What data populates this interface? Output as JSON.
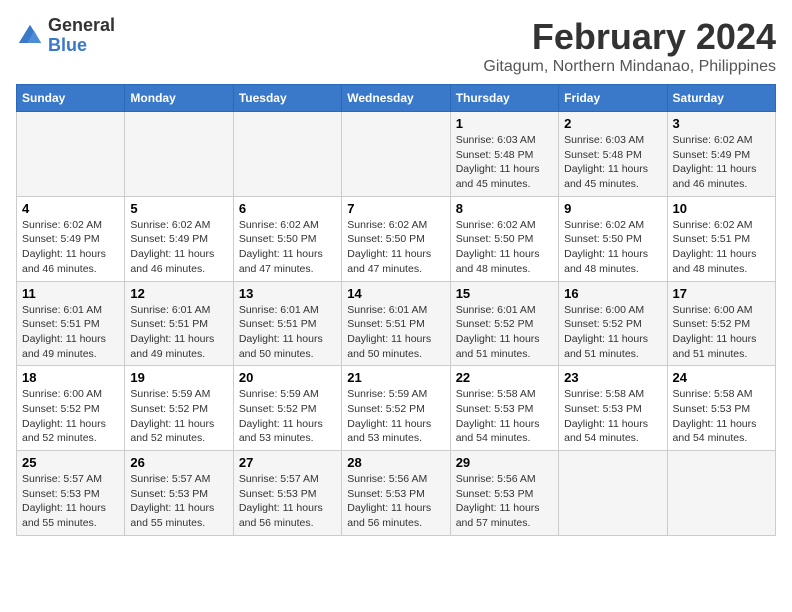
{
  "logo": {
    "line1": "General",
    "line2": "Blue"
  },
  "title": "February 2024",
  "subtitle": "Gitagum, Northern Mindanao, Philippines",
  "days_of_week": [
    "Sunday",
    "Monday",
    "Tuesday",
    "Wednesday",
    "Thursday",
    "Friday",
    "Saturday"
  ],
  "weeks": [
    [
      {
        "day": "",
        "info": ""
      },
      {
        "day": "",
        "info": ""
      },
      {
        "day": "",
        "info": ""
      },
      {
        "day": "",
        "info": ""
      },
      {
        "day": "1",
        "info": "Sunrise: 6:03 AM\nSunset: 5:48 PM\nDaylight: 11 hours and 45 minutes."
      },
      {
        "day": "2",
        "info": "Sunrise: 6:03 AM\nSunset: 5:48 PM\nDaylight: 11 hours and 45 minutes."
      },
      {
        "day": "3",
        "info": "Sunrise: 6:02 AM\nSunset: 5:49 PM\nDaylight: 11 hours and 46 minutes."
      }
    ],
    [
      {
        "day": "4",
        "info": "Sunrise: 6:02 AM\nSunset: 5:49 PM\nDaylight: 11 hours and 46 minutes."
      },
      {
        "day": "5",
        "info": "Sunrise: 6:02 AM\nSunset: 5:49 PM\nDaylight: 11 hours and 46 minutes."
      },
      {
        "day": "6",
        "info": "Sunrise: 6:02 AM\nSunset: 5:50 PM\nDaylight: 11 hours and 47 minutes."
      },
      {
        "day": "7",
        "info": "Sunrise: 6:02 AM\nSunset: 5:50 PM\nDaylight: 11 hours and 47 minutes."
      },
      {
        "day": "8",
        "info": "Sunrise: 6:02 AM\nSunset: 5:50 PM\nDaylight: 11 hours and 48 minutes."
      },
      {
        "day": "9",
        "info": "Sunrise: 6:02 AM\nSunset: 5:50 PM\nDaylight: 11 hours and 48 minutes."
      },
      {
        "day": "10",
        "info": "Sunrise: 6:02 AM\nSunset: 5:51 PM\nDaylight: 11 hours and 48 minutes."
      }
    ],
    [
      {
        "day": "11",
        "info": "Sunrise: 6:01 AM\nSunset: 5:51 PM\nDaylight: 11 hours and 49 minutes."
      },
      {
        "day": "12",
        "info": "Sunrise: 6:01 AM\nSunset: 5:51 PM\nDaylight: 11 hours and 49 minutes."
      },
      {
        "day": "13",
        "info": "Sunrise: 6:01 AM\nSunset: 5:51 PM\nDaylight: 11 hours and 50 minutes."
      },
      {
        "day": "14",
        "info": "Sunrise: 6:01 AM\nSunset: 5:51 PM\nDaylight: 11 hours and 50 minutes."
      },
      {
        "day": "15",
        "info": "Sunrise: 6:01 AM\nSunset: 5:52 PM\nDaylight: 11 hours and 51 minutes."
      },
      {
        "day": "16",
        "info": "Sunrise: 6:00 AM\nSunset: 5:52 PM\nDaylight: 11 hours and 51 minutes."
      },
      {
        "day": "17",
        "info": "Sunrise: 6:00 AM\nSunset: 5:52 PM\nDaylight: 11 hours and 51 minutes."
      }
    ],
    [
      {
        "day": "18",
        "info": "Sunrise: 6:00 AM\nSunset: 5:52 PM\nDaylight: 11 hours and 52 minutes."
      },
      {
        "day": "19",
        "info": "Sunrise: 5:59 AM\nSunset: 5:52 PM\nDaylight: 11 hours and 52 minutes."
      },
      {
        "day": "20",
        "info": "Sunrise: 5:59 AM\nSunset: 5:52 PM\nDaylight: 11 hours and 53 minutes."
      },
      {
        "day": "21",
        "info": "Sunrise: 5:59 AM\nSunset: 5:52 PM\nDaylight: 11 hours and 53 minutes."
      },
      {
        "day": "22",
        "info": "Sunrise: 5:58 AM\nSunset: 5:53 PM\nDaylight: 11 hours and 54 minutes."
      },
      {
        "day": "23",
        "info": "Sunrise: 5:58 AM\nSunset: 5:53 PM\nDaylight: 11 hours and 54 minutes."
      },
      {
        "day": "24",
        "info": "Sunrise: 5:58 AM\nSunset: 5:53 PM\nDaylight: 11 hours and 54 minutes."
      }
    ],
    [
      {
        "day": "25",
        "info": "Sunrise: 5:57 AM\nSunset: 5:53 PM\nDaylight: 11 hours and 55 minutes."
      },
      {
        "day": "26",
        "info": "Sunrise: 5:57 AM\nSunset: 5:53 PM\nDaylight: 11 hours and 55 minutes."
      },
      {
        "day": "27",
        "info": "Sunrise: 5:57 AM\nSunset: 5:53 PM\nDaylight: 11 hours and 56 minutes."
      },
      {
        "day": "28",
        "info": "Sunrise: 5:56 AM\nSunset: 5:53 PM\nDaylight: 11 hours and 56 minutes."
      },
      {
        "day": "29",
        "info": "Sunrise: 5:56 AM\nSunset: 5:53 PM\nDaylight: 11 hours and 57 minutes."
      },
      {
        "day": "",
        "info": ""
      },
      {
        "day": "",
        "info": ""
      }
    ]
  ]
}
